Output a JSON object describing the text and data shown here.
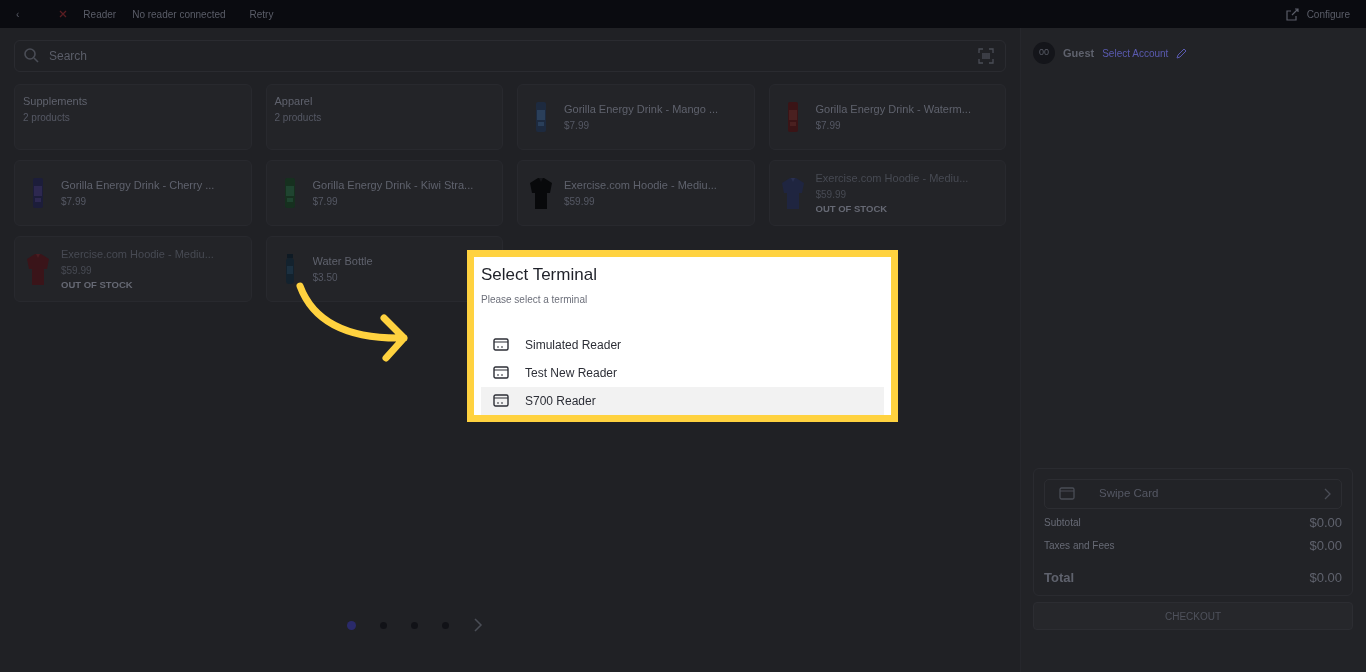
{
  "top_bar": {
    "back": "‹",
    "reader_label": "Reader",
    "reader_status": "No reader connected",
    "retry": "Retry",
    "configure": "Configure"
  },
  "search": {
    "placeholder": "Search"
  },
  "grid": [
    {
      "kind": "category",
      "name": "Supplements",
      "count": "2 products"
    },
    {
      "kind": "category",
      "name": "Apparel",
      "count": "2 products"
    },
    {
      "kind": "product",
      "name": "Gorilla Energy Drink - Mango ...",
      "price": "$7.99",
      "disabled": false
    },
    {
      "kind": "product",
      "name": "Gorilla Energy Drink - Waterm...",
      "price": "$7.99",
      "disabled": false
    },
    {
      "kind": "product",
      "name": "Gorilla Energy Drink - Cherry ...",
      "price": "$7.99",
      "disabled": false
    },
    {
      "kind": "product",
      "name": "Gorilla Energy Drink - Kiwi Stra...",
      "price": "$7.99",
      "disabled": false
    },
    {
      "kind": "product",
      "name": "Exercise.com Hoodie - Mediu...",
      "price": "$59.99",
      "disabled": false
    },
    {
      "kind": "product",
      "name": "Exercise.com Hoodie - Mediu...",
      "price": "$59.99",
      "disabled": true,
      "note": "OUT OF STOCK"
    },
    {
      "kind": "product",
      "name": "Exercise.com Hoodie - Mediu...",
      "price": "$59.99",
      "disabled": true,
      "note": "OUT OF STOCK"
    },
    {
      "kind": "product",
      "name": "Water Bottle",
      "price": "$3.50",
      "disabled": false
    }
  ],
  "pagination": [
    {
      "selected": true
    },
    {
      "selected": false
    },
    {
      "selected": false
    },
    {
      "selected": false
    }
  ],
  "customer": {
    "avatar": "00",
    "name": "Guest",
    "link": "Select Account"
  },
  "cart": {
    "payment": "Swipe Card",
    "rows": [
      {
        "kind": "line",
        "label": "Subtotal",
        "value": "$0.00"
      },
      {
        "kind": "line",
        "label": "Taxes and Fees",
        "value": "$0.00"
      },
      {
        "kind": "total",
        "label": "Total",
        "value": "$0.00"
      }
    ],
    "checkout": "CHECKOUT"
  },
  "dialog": {
    "title": "Select Terminal",
    "subtitle": "Please select a terminal",
    "terminals": [
      {
        "name": "Simulated Reader",
        "selected": false
      },
      {
        "name": "Test New Reader",
        "selected": false
      },
      {
        "name": "S700 Reader",
        "selected": true
      }
    ]
  }
}
